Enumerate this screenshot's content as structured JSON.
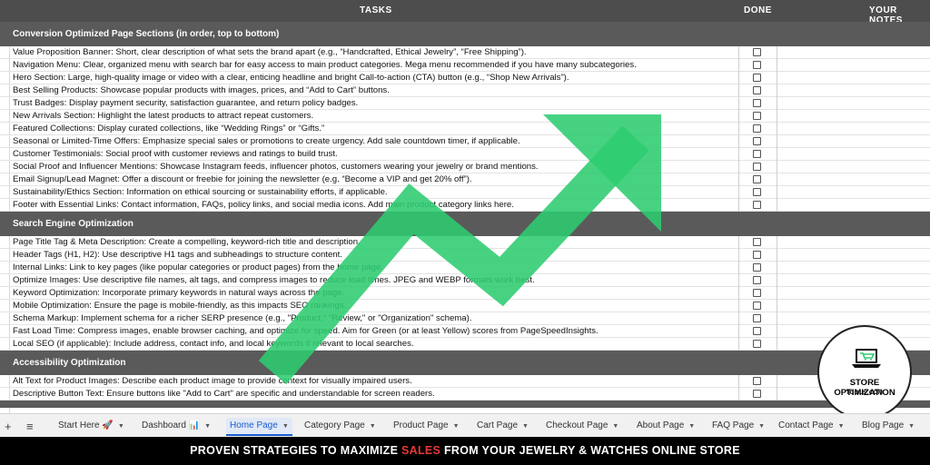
{
  "header": {
    "tasks": "TASKS",
    "done": "DONE",
    "notes": "YOUR NOTES"
  },
  "sections": [
    {
      "title": "Conversion Optimized Page Sections (in order, top to bottom)",
      "items": [
        "Value Proposition Banner: Short, clear description of what sets the brand apart (e.g., “Handcrafted, Ethical Jewelry”, “Free Shipping”).",
        "Navigation Menu: Clear, organized menu with search bar for easy access to main product categories. Mega menu recommended if you have many subcategories.",
        "Hero Section: Large, high-quality image or video with a clear, enticing headline and bright Call-to-action (CTA) button (e.g., “Shop New Arrivals”).",
        "Best Selling Products: Showcase popular products with images, prices, and “Add to Cart” buttons.",
        "Trust Badges: Display payment security, satisfaction guarantee, and return policy badges.",
        "New Arrivals Section: Highlight the latest products to attract repeat customers.",
        "Featured Collections: Display curated collections, like “Wedding Rings” or “Gifts.”",
        "Seasonal or Limited-Time Offers: Emphasize special sales or promotions to create urgency. Add sale countdown timer, if applicable.",
        "Customer Testimonials: Social proof with customer reviews and ratings to build trust.",
        "Social Proof and Influencer Mentions: Showcase Instagram feeds, influencer photos, customers wearing your jewelry or brand mentions.",
        "Email Signup/Lead Magnet: Offer a discount or freebie for joining the newsletter (e.g. “Become a VIP and get 20% off”).",
        "Sustainability/Ethics Section: Information on ethical sourcing or sustainability efforts, if applicable.",
        "Footer with Essential Links: Contact information, FAQs, policy links, and social media icons. Add main product category links here."
      ]
    },
    {
      "title": "Search Engine Optimization",
      "items": [
        "Page Title Tag & Meta Description: Create a compelling, keyword-rich title and description.",
        "Header Tags (H1, H2): Use descriptive H1 tags and subheadings to structure content.",
        "Internal Links: Link to key pages (like popular categories or product pages) from the home page.",
        "Optimize Images: Use descriptive file names, alt tags, and compress images to reduce load times. JPEG and WEBP formats work best.",
        "Keyword Optimization: Incorporate primary keywords in natural ways across the page.",
        "Mobile Optimization: Ensure the page is mobile-friendly, as this impacts SEO rankings.",
        "Schema Markup: Implement schema for a richer SERP presence (e.g., \"Product,\" \"Review,\" or \"Organization\" schema).",
        "Fast Load Time: Compress images, enable browser caching, and optimize for speed. Aim for Green (or at least Yellow) scores from PageSpeedInsights.",
        "Local SEO (if applicable): Include address, contact info, and local keywords if relevant to local searches."
      ]
    },
    {
      "title": "Accessibility Optimization",
      "items": [
        "Alt Text for Product Images: Describe each product image to provide context for visually impaired users.",
        "Descriptive Button Text: Ensure buttons like \"Add to Cart\" are specific and understandable for screen readers."
      ]
    }
  ],
  "tabs": [
    {
      "label": "Start Here 🚀",
      "active": false
    },
    {
      "label": "Dashboard 📊",
      "active": false
    },
    {
      "label": "Home Page",
      "active": true
    },
    {
      "label": "Category Page",
      "active": false
    },
    {
      "label": "Product Page",
      "active": false
    },
    {
      "label": "Cart Page",
      "active": false
    },
    {
      "label": "Checkout Page",
      "active": false
    },
    {
      "label": "About Page",
      "active": false
    },
    {
      "label": "FAQ Page",
      "active": false
    },
    {
      "label": "Contact Page",
      "active": false
    },
    {
      "label": "Blog Page",
      "active": false
    }
  ],
  "tabbar_controls": {
    "add": "+",
    "menu": "≡"
  },
  "badge": {
    "line1": "STORE OPTIMIZATION",
    "line2": "TOOLS.COM"
  },
  "banner": {
    "before": "PROVEN STRATEGIES TO MAXIMIZE ",
    "highlight": "SALES",
    "after": " FROM YOUR JEWELRY & WATCHES ONLINE STORE"
  },
  "colors": {
    "arrow": "#2ecc71",
    "section_bg": "#5a5a5a",
    "header_bg": "#4d4d4d",
    "active_tab": "#1a5bd0",
    "highlight": "#e53935",
    "cart_icon": "#2ecc71"
  },
  "icons": {
    "arrow": "green-growth-arrow-icon",
    "badge_logo": "laptop-cart-icon",
    "checkbox": "checkbox-icon"
  }
}
